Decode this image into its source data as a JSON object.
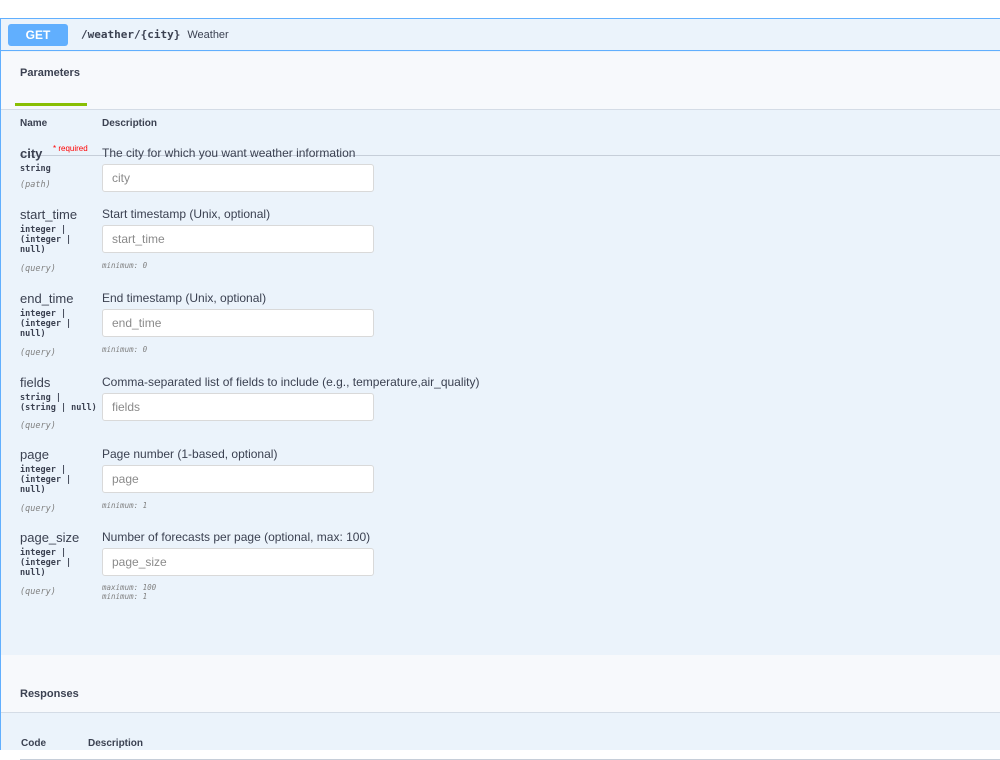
{
  "operation": {
    "method": "GET",
    "path": "/weather/{city}",
    "summary": "Weather"
  },
  "parameters_tab": "Parameters",
  "table_headers": {
    "name": "Name",
    "description": "Description"
  },
  "parameters": [
    {
      "name": "city",
      "required_marker": "* required",
      "type": "string",
      "in": "(path)",
      "description": "The city for which you want weather information",
      "placeholder": "city",
      "constraints": ""
    },
    {
      "name": "start_time",
      "type": "integer |\n(integer |\nnull)",
      "in": "(query)",
      "description": "Start timestamp (Unix, optional)",
      "placeholder": "start_time",
      "constraints": "minimum: 0"
    },
    {
      "name": "end_time",
      "type": "integer |\n(integer |\nnull)",
      "in": "(query)",
      "description": "End timestamp (Unix, optional)",
      "placeholder": "end_time",
      "constraints": "minimum: 0"
    },
    {
      "name": "fields",
      "type": "string |\n(string | null)",
      "in": "(query)",
      "description": "Comma-separated list of fields to include (e.g., temperature,air_quality)",
      "placeholder": "fields",
      "constraints": ""
    },
    {
      "name": "page",
      "type": "integer |\n(integer |\nnull)",
      "in": "(query)",
      "description": "Page number (1-based, optional)",
      "placeholder": "page",
      "constraints": "minimum: 1"
    },
    {
      "name": "page_size",
      "type": "integer |\n(integer |\nnull)",
      "in": "(query)",
      "description": "Number of forecasts per page (optional, max: 100)",
      "placeholder": "page_size",
      "constraints": "maximum: 100\nminimum: 1"
    }
  ],
  "responses_tab": "Responses",
  "response_headers": {
    "code": "Code",
    "description": "Description"
  },
  "colors": {
    "get_accent": "#61affe",
    "get_background": "#ebf3fb",
    "tab_underline": "#89bf04",
    "required": "#ff0000"
  }
}
